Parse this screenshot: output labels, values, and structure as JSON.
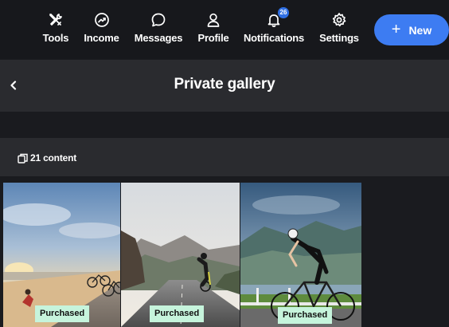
{
  "nav": {
    "items": [
      {
        "label": "Tools",
        "icon": "tools-icon"
      },
      {
        "label": "Income",
        "icon": "income-icon"
      },
      {
        "label": "Messages",
        "icon": "messages-icon"
      },
      {
        "label": "Profile",
        "icon": "profile-icon"
      },
      {
        "label": "Notifications",
        "icon": "bell-icon",
        "badge": "26"
      },
      {
        "label": "Settings",
        "icon": "gear-icon"
      }
    ],
    "new_button": {
      "plus": "+",
      "label": "New"
    }
  },
  "header": {
    "title": "Private gallery"
  },
  "content": {
    "count_label": "21 content"
  },
  "gallery": {
    "items": [
      {
        "scene": "cyclists resting by the sea at sunset",
        "tag": "Purchased"
      },
      {
        "scene": "cyclist riding on a mountain road",
        "tag": "Purchased"
      },
      {
        "scene": "woman cyclist riding by a lake and mountains",
        "tag": "Purchased"
      }
    ]
  },
  "colors": {
    "accent": "#3d7cf2",
    "tag_bg": "#c6f4dc",
    "bg": "#1a1b1f",
    "panel": "#2a2b2f"
  }
}
